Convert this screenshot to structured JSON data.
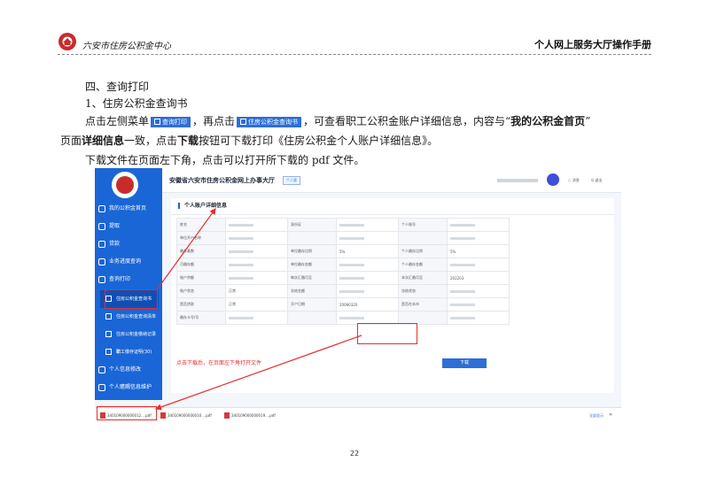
{
  "header": {
    "org": "六安市住房公积金中心",
    "title": "个人网上服务大厅操作手册"
  },
  "section": {
    "heading": "四、查询打印",
    "subheading": "1、住房公积金查询书",
    "p1_a": "点击左侧菜单",
    "chip_menu": "查询打印",
    "p1_b": "，再点击",
    "chip_sub": "住房公积金查询书",
    "p1_c": "，可查看职工公积金账户详细信息，内容与“",
    "p1_bold": "我的公积金首页",
    "p1_d": "”",
    "p2_a": "页面",
    "p2_bold1": "详细信息",
    "p2_b": "一致，点击",
    "p2_bold2": "下载",
    "p2_c": "按钮可下载打印《住房公积金个人账户详细信息》。",
    "p3": "下载文件在页面左下角，点击可以打开所下载的 pdf 文件。"
  },
  "screenshot": {
    "app_title": "安徽省六安市住房公积金网上办事大厅",
    "tag": "个人版",
    "top_links": [
      "○ 消息",
      "⏻ 退出"
    ],
    "sidebar": [
      "我的公积金首页",
      "提取",
      "贷款",
      "业务进度查询",
      "查询打印",
      "个人信息修改",
      "个人赡赐信息维护"
    ],
    "sidebar_sub": [
      "住房公积金查询书",
      "住房公积金查询清单",
      "住房公积金缴纳记录单",
      "职工缴存证明(30)"
    ],
    "card_title": "个人账户详细信息",
    "rows": [
      [
        "姓名",
        "",
        "身份证",
        "",
        "个人账号",
        ""
      ],
      [
        "单位开户名称",
        "",
        "",
        "",
        "",
        ""
      ],
      [
        "缴存基数",
        "",
        "单位缴存比例",
        "5%",
        "个人缴存比例",
        "5%"
      ],
      [
        "月缴存额",
        "",
        "单位缴存金额",
        "",
        "个人缴存金额",
        ""
      ],
      [
        "账户余额",
        "",
        "每次汇缴月至",
        "",
        "末次汇缴月至",
        "202203"
      ],
      [
        "账户状态",
        "正常",
        "冻结金额",
        "",
        "冻结状态",
        ""
      ],
      [
        "是否贷款",
        "正常",
        "开户日期",
        "20090320",
        "是否在本市",
        ""
      ],
      [
        "缴存卡号/号",
        "",
        "",
        "",
        "",
        ""
      ]
    ],
    "download_button": "下载",
    "annotation": "点击下载后，在页面左下角打开文件",
    "files": [
      "340109000000012....pdf",
      "340109000000010....pdf",
      "340109000000019....pdf"
    ],
    "show_all": "全部显示",
    "close": "✕"
  },
  "page_number": "22"
}
